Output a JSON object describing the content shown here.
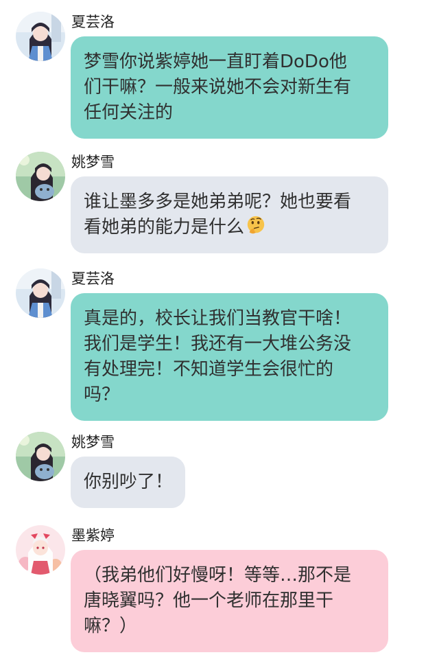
{
  "messages": [
    {
      "sender": "夏芸洛",
      "avatar_icon": "avatar-xia-yunluo-icon",
      "bubble_color": "#84d7cc",
      "lines": [
        "梦雪你说紫婷她一直盯着DoDo他",
        "们干嘛？一般来说她不会对新生有",
        "任何关注的"
      ]
    },
    {
      "sender": "姚梦雪",
      "avatar_icon": "avatar-yao-mengxue-icon",
      "bubble_color": "#e3e7ee",
      "lines": [
        "谁让墨多多是她弟弟呢？她也要看",
        "看她弟的能力是什么"
      ],
      "emoji": "thinking-face-icon"
    },
    {
      "sender": "夏芸洛",
      "avatar_icon": "avatar-xia-yunluo-icon",
      "bubble_color": "#84d7cc",
      "lines": [
        "真是的，校长让我们当教官干啥！",
        "我们是学生！我还有一大堆公务没",
        "有处理完！不知道学生会很忙的",
        "吗？"
      ]
    },
    {
      "sender": "姚梦雪",
      "avatar_icon": "avatar-yao-mengxue-icon",
      "bubble_color": "#e3e7ee",
      "lines": [
        "你别吵了！"
      ]
    },
    {
      "sender": "墨紫婷",
      "avatar_icon": "avatar-mo-ziting-icon",
      "bubble_color": "#fccdd8",
      "lines": [
        "（我弟他们好慢呀！等等…那不是",
        "唐晓翼吗？他一个老师在那里干",
        "嘛？）"
      ]
    }
  ]
}
